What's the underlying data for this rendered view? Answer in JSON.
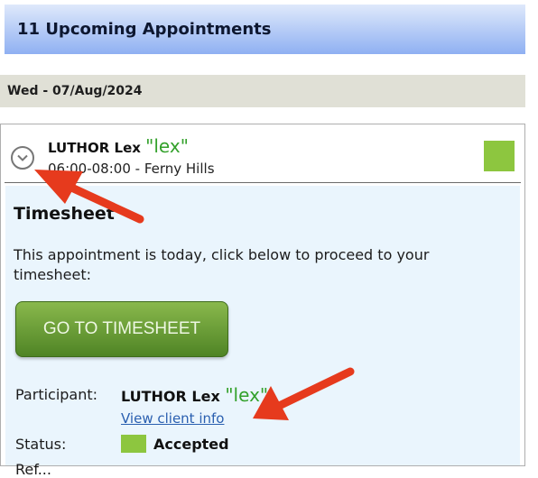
{
  "header": {
    "title": "11 Upcoming Appointments"
  },
  "date_bar": {
    "label": "Wed - 07/Aug/2024"
  },
  "appointment": {
    "name": "LUTHOR Lex",
    "nickname": "\"lex\"",
    "time_location": "06:00-08:00 - Ferny Hills",
    "status_color": "#8dc63f"
  },
  "timesheet": {
    "title": "Timesheet",
    "message": "This appointment is today, click below to proceed to your timesheet:",
    "button_label": "GO TO TIMESHEET"
  },
  "details": {
    "participant_label": "Participant:",
    "participant_name": "LUTHOR Lex",
    "participant_nickname": "\"lex\"",
    "client_link": "View client info",
    "status_label": "Status:",
    "status_value": "Accepted",
    "ref_label": "Ref..."
  },
  "icons": {
    "collapse": "chevron-down-circle-icon"
  },
  "colors": {
    "accent_green": "#8dc63f",
    "nickname_green": "#33a12b",
    "annotation_red": "#e63a1d"
  }
}
